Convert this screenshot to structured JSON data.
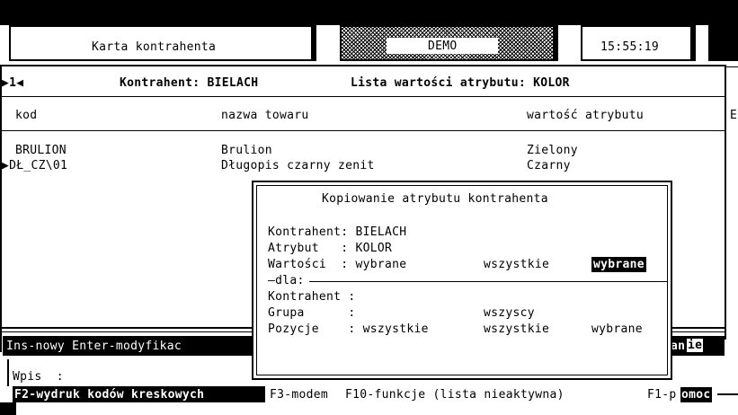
{
  "header": {
    "title": "Karta kontrahenta",
    "mode": "DEMO",
    "clock": "15:55:19"
  },
  "list": {
    "nav_marker": "▶1◀",
    "contractor_label": "Kontrahent: BIELACH",
    "attribute_list_label": "Lista wartości atrybutu: KOLOR",
    "columns": {
      "code": "kod",
      "name": "nazwa towaru",
      "value": "wartość atrybutu",
      "edge": "E"
    },
    "rows": [
      {
        "code": "BRULION",
        "name": "Brulion",
        "value": "Zielony"
      },
      {
        "code": "▶DŁ_CZ\\01",
        "name": "Długopis czarny zenit",
        "value": "Czarny"
      }
    ]
  },
  "dialog": {
    "title": "Kopiowanie atrybutu kontrahenta",
    "contractor_line": "Kontrahent: BIELACH",
    "attribute_line": "Atrybut   : KOLOR",
    "values_label": "Wartości  : wybrane",
    "values_option_all": "wszystkie",
    "values_option_selected": "wybrane",
    "for_label": "—dla:",
    "for_contractor_label": "Kontrahent :",
    "group_label": "Grupa      :",
    "group_value": "wszyscy",
    "positions_label": "Pozycje    : wszystkie",
    "positions_option_all": "wszystkie",
    "positions_option_selected": "wybrane"
  },
  "status": {
    "hint_left": "Ins-nowy Enter-modyfikac",
    "hint_right_prefix": "an",
    "hint_right_highlight": "ie"
  },
  "footer": {
    "input_label": "Wpis  :",
    "f2": "F2-wydruk kodów kreskowych",
    "f3": "F3-modem",
    "f10": "F10-funkcje (lista nieaktywna)",
    "f1_prefix": "F1-p",
    "f1_highlight": "omoc"
  }
}
